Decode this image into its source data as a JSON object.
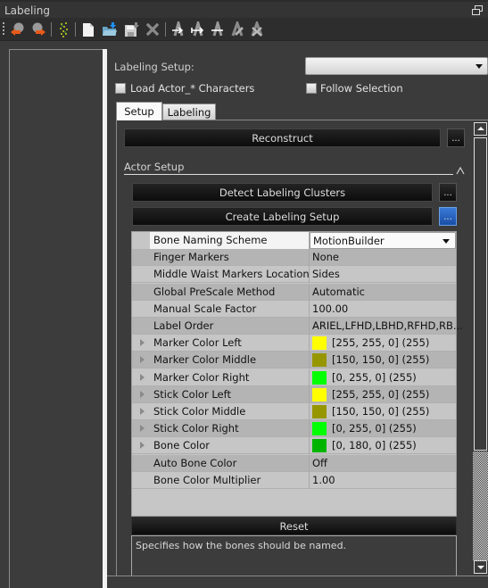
{
  "window": {
    "title": "Labeling"
  },
  "toolbar": {
    "buttons": [
      {
        "icon": "undo-icon",
        "label": "Undo"
      },
      {
        "icon": "redo-icon",
        "label": "Redo"
      },
      {
        "icon": "markers-tree-icon",
        "label": "Markers"
      },
      {
        "icon": "new-file-icon",
        "label": "New"
      },
      {
        "icon": "open-folder-icon",
        "label": "Open"
      },
      {
        "icon": "save-icon",
        "label": "Save"
      },
      {
        "icon": "delete-icon",
        "label": "Delete"
      },
      {
        "icon": "label-forward-icon",
        "label": "Label Forward"
      },
      {
        "icon": "label-both-icon",
        "label": "Label Both"
      },
      {
        "icon": "label-cut-icon",
        "label": "Label Cut"
      },
      {
        "icon": "label-edit-icon",
        "label": "Label Edit"
      },
      {
        "icon": "label-clear-icon",
        "label": "Label Clear"
      }
    ]
  },
  "setup": {
    "label": "Labeling Setup:",
    "combo_value": "",
    "load_actor_label": "Load Actor_* Characters",
    "load_actor_checked": false,
    "follow_selection_label": "Follow Selection",
    "follow_selection_checked": false
  },
  "tabs": [
    {
      "label": "Setup",
      "active": true
    },
    {
      "label": "Labeling",
      "active": false
    }
  ],
  "buttons": {
    "reconstruct": "Reconstruct",
    "more": "...",
    "detect": "Detect Labeling Clusters",
    "create": "Create Labeling Setup",
    "reset": "Reset"
  },
  "section": {
    "title": "Actor Setup",
    "collapse_glyph": "^"
  },
  "properties": [
    {
      "name": "Bone Naming Scheme",
      "value": "MotionBuilder",
      "type": "combo",
      "selected": true
    },
    {
      "name": "Finger Markers",
      "value": "None"
    },
    {
      "name": "Middle Waist Markers Location",
      "value": "Sides"
    },
    {
      "name": "Global PreScale Method",
      "value": "Automatic"
    },
    {
      "name": "Manual Scale Factor",
      "value": "100.00"
    },
    {
      "name": "Label Order",
      "value": "ARIEL,LFHD,LBHD,RFHD,RB..."
    },
    {
      "name": "Marker Color Left",
      "value": "[255, 255, 0] (255)",
      "color": "#ffff00",
      "expandable": true
    },
    {
      "name": "Marker Color Middle",
      "value": "[150, 150, 0] (255)",
      "color": "#969600",
      "expandable": true
    },
    {
      "name": "Marker Color Right",
      "value": "[0, 255, 0] (255)",
      "color": "#00ff00",
      "expandable": true
    },
    {
      "name": "Stick Color Left",
      "value": "[255, 255, 0] (255)",
      "color": "#ffff00",
      "expandable": true
    },
    {
      "name": "Stick Color Middle",
      "value": "[150, 150, 0] (255)",
      "color": "#969600",
      "expandable": true
    },
    {
      "name": "Stick Color Right",
      "value": "[0, 255, 0] (255)",
      "color": "#00ff00",
      "expandable": true
    },
    {
      "name": "Bone Color",
      "value": "[0, 180, 0] (255)",
      "color": "#00b400",
      "expandable": true
    },
    {
      "name": "Auto Bone Color",
      "value": "Off"
    },
    {
      "name": "Bone Color Multiplier",
      "value": "1.00"
    }
  ],
  "description": "Specifies how the bones should be named.",
  "colors": {
    "accent_blue": "#2a64c0",
    "panel_bg": "#3b3b3b"
  }
}
